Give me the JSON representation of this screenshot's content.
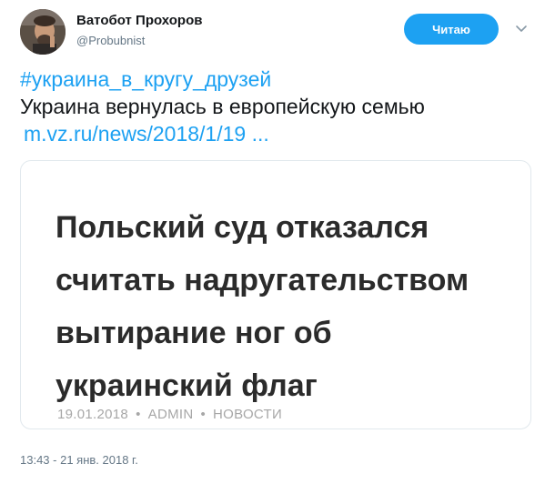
{
  "author": {
    "name": "Ватобот Прохоров",
    "handle": "@Probubnist"
  },
  "follow_button": {
    "label": "Читаю",
    "color": "#1da1f2"
  },
  "menu_icon": "chevron-down-icon",
  "tweet": {
    "hashtag": "#украина_в_кругу_друзей",
    "text": "Украина вернулась в европейскую семью",
    "link": "m.vz.ru/news/2018/1/19 ..."
  },
  "card": {
    "headline_lines": [
      "Польский суд отказался",
      "считать надругательством",
      "вытирание ног об",
      "украинский флаг"
    ],
    "date": "19.01.2018",
    "author": "ADMIN",
    "category": "НОВОСТИ",
    "separator": "•"
  },
  "timestamp": "13:43 - 21 янв. 2018 г."
}
